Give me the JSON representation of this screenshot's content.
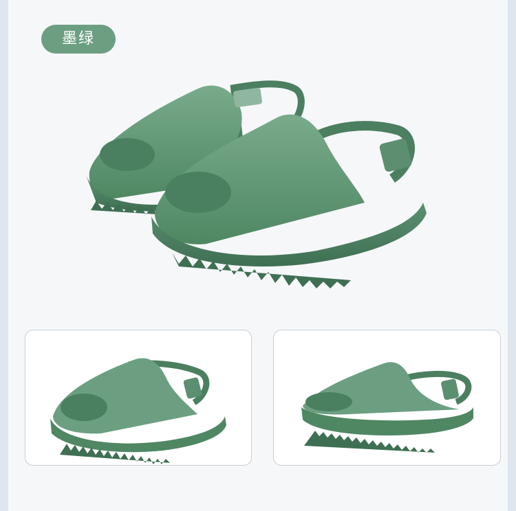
{
  "color_badge": {
    "label": "墨绿"
  },
  "colors": {
    "page_background": "#dfe6ee",
    "panel_background": "#f6f7f9",
    "badge_fill": "#6c9f82",
    "product_green": "#5f9674",
    "product_green_dark": "#3f6f53",
    "product_green_light": "#86b598",
    "thumbnail_border": "#c9ced4"
  },
  "images": {
    "hero": "pair-of-green-kids-slide-sandals-icon",
    "thumbnail_left": "green-slide-sandal-side-view-icon",
    "thumbnail_right": "green-slide-sandal-profile-view-icon"
  }
}
